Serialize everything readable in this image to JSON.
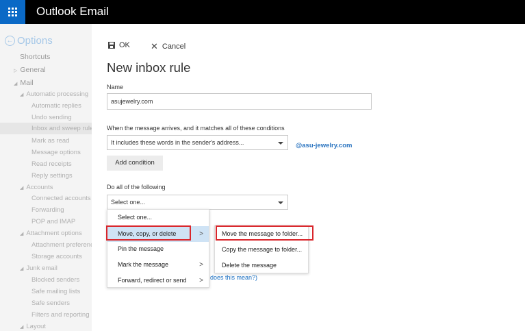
{
  "header": {
    "app_title": "Outlook Email",
    "waffle_icon": "app-launcher-icon",
    "bg_color": "#000000",
    "accent_color": "#0a69c6"
  },
  "sidebar": {
    "options_label": "Options",
    "shortcuts": "Shortcuts",
    "general": "General",
    "mail": "Mail",
    "automatic_processing": "Automatic processing",
    "automatic_replies": "Automatic replies",
    "undo_sending": "Undo sending",
    "inbox_sweep_rules": "Inbox and sweep rules",
    "mark_as_read": "Mark as read",
    "message_options": "Message options",
    "read_receipts": "Read receipts",
    "reply_settings": "Reply settings",
    "accounts": "Accounts",
    "connected_accounts": "Connected accounts",
    "forwarding": "Forwarding",
    "pop_imap": "POP and IMAP",
    "attachment_options": "Attachment options",
    "attachment_preferences": "Attachment preferenc",
    "storage_accounts": "Storage accounts",
    "junk_email": "Junk email",
    "blocked_senders": "Blocked senders",
    "safe_mailing_lists": "Safe mailing lists",
    "safe_senders": "Safe senders",
    "filters_reporting": "Filters and reporting",
    "layout": "Layout"
  },
  "toolbar": {
    "ok_label": "OK",
    "cancel_label": "Cancel"
  },
  "form": {
    "title": "New inbox rule",
    "name_label": "Name",
    "name_value": "asujewelry.com",
    "condition_label": "When the message arrives, and it matches all of these conditions",
    "condition_value": "It includes these words in the sender's address...",
    "sender_note": "@asu-jewelry.com",
    "add_condition": "Add condition",
    "action_label": "Do all of the following",
    "action_value": "Select one...",
    "help_link_fragment": "t does this mean?)"
  },
  "action_menu": {
    "items": [
      {
        "label": "Select one...",
        "has_submenu": false
      },
      {
        "label": "Move, copy, or delete",
        "has_submenu": true
      },
      {
        "label": "Pin the message",
        "has_submenu": false
      },
      {
        "label": "Mark the message",
        "has_submenu": true
      },
      {
        "label": "Forward, redirect or send",
        "has_submenu": true
      }
    ],
    "chevron": ">"
  },
  "sub_menu": {
    "items": [
      {
        "label": "Move the message to folder..."
      },
      {
        "label": "Copy the message to folder..."
      },
      {
        "label": "Delete the message"
      }
    ]
  },
  "highlight_color": "#d9262b"
}
